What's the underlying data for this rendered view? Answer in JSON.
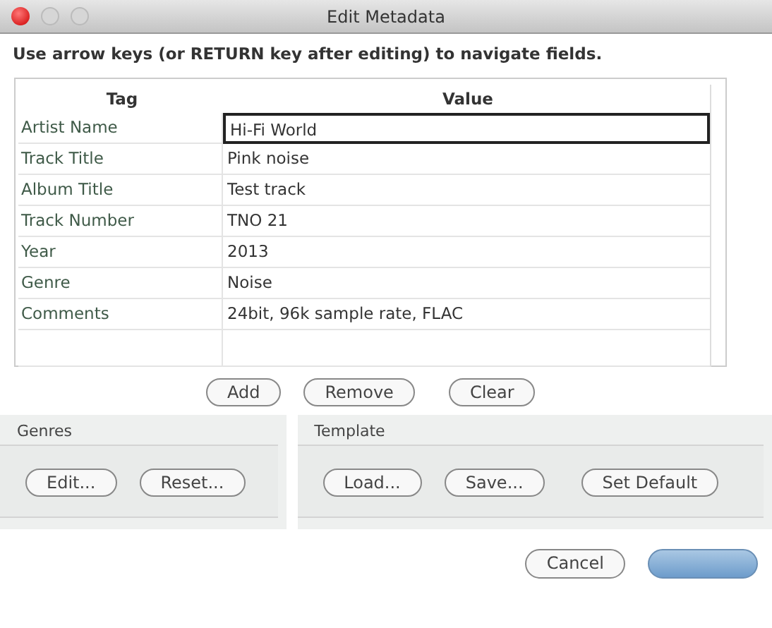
{
  "window": {
    "title": "Edit Metadata",
    "controls": [
      {
        "active": true
      },
      {
        "active": false
      },
      {
        "active": false
      }
    ]
  },
  "instructions": "Use arrow keys (or RETURN key after editing) to navigate fields.",
  "table": {
    "columns": [
      "Tag",
      "Value"
    ],
    "rows": [
      {
        "tag": "Artist Name",
        "value": "Hi-Fi World",
        "editing": true
      },
      {
        "tag": "Track Title",
        "value": "Pink noise",
        "editing": false
      },
      {
        "tag": "Album Title",
        "value": "Test track",
        "editing": false
      },
      {
        "tag": "Track Number",
        "value": "TNO 21",
        "editing": false
      },
      {
        "tag": "Year",
        "value": "2013",
        "editing": false
      },
      {
        "tag": "Genre",
        "value": "Noise",
        "editing": false
      },
      {
        "tag": "Comments",
        "value": "24bit, 96k sample rate, FLAC",
        "editing": false
      }
    ]
  },
  "table_buttons": [
    "Add",
    "Remove",
    "Clear"
  ],
  "genres": {
    "title": "Genres",
    "buttons": [
      "Edit...",
      "Reset..."
    ]
  },
  "template": {
    "title": "Template",
    "buttons": [
      "Load...",
      "Save...",
      "Set Default"
    ]
  },
  "dialog_buttons": [
    {
      "label": "Cancel",
      "default": false
    },
    {
      "default": true
    }
  ]
}
